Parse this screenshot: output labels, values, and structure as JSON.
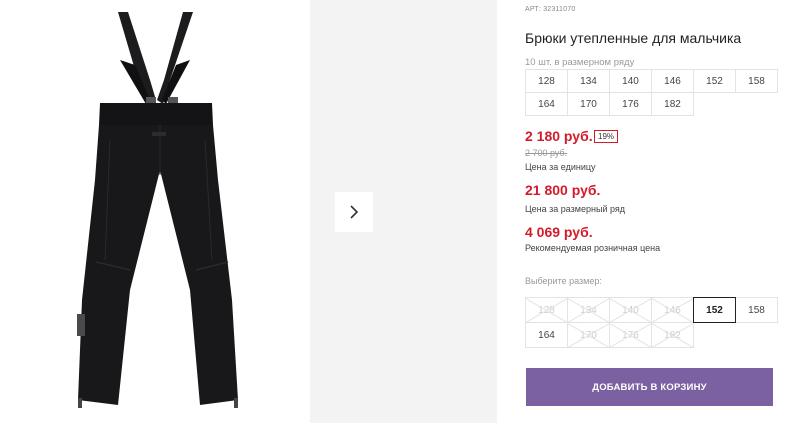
{
  "product": {
    "article_label": "АРТ:",
    "article": "32311070",
    "title": "Брюки утепленные для мальчика",
    "row_note": "10 шт. в размерном ряду",
    "row_sizes": [
      "128",
      "134",
      "140",
      "146",
      "152",
      "158",
      "164",
      "170",
      "176",
      "182"
    ],
    "price_unit": "2 180 руб.",
    "discount": "19%",
    "old_price": "2 700 руб.",
    "price_unit_caption": "Цена за единицу",
    "price_row": "21 800 руб.",
    "price_row_caption": "Цена за размерный ряд",
    "price_retail": "4 069 руб.",
    "price_retail_caption": "Рекомендуемая розничная цена",
    "choose_label": "Выберите размер:",
    "choose_sizes": [
      {
        "label": "128",
        "state": "disabled"
      },
      {
        "label": "134",
        "state": "disabled"
      },
      {
        "label": "140",
        "state": "disabled"
      },
      {
        "label": "146",
        "state": "disabled"
      },
      {
        "label": "152",
        "state": "selected"
      },
      {
        "label": "158",
        "state": "available"
      },
      {
        "label": "164",
        "state": "available"
      },
      {
        "label": "170",
        "state": "disabled"
      },
      {
        "label": "176",
        "state": "disabled"
      },
      {
        "label": "182",
        "state": "disabled"
      }
    ],
    "add_to_cart": "ДОБАВИТЬ В КОРЗИНУ"
  },
  "gallery": {
    "next_icon": "chevron-right-icon"
  },
  "colors": {
    "price_red": "#d41b2c",
    "button_purple": "#7b61a1"
  }
}
